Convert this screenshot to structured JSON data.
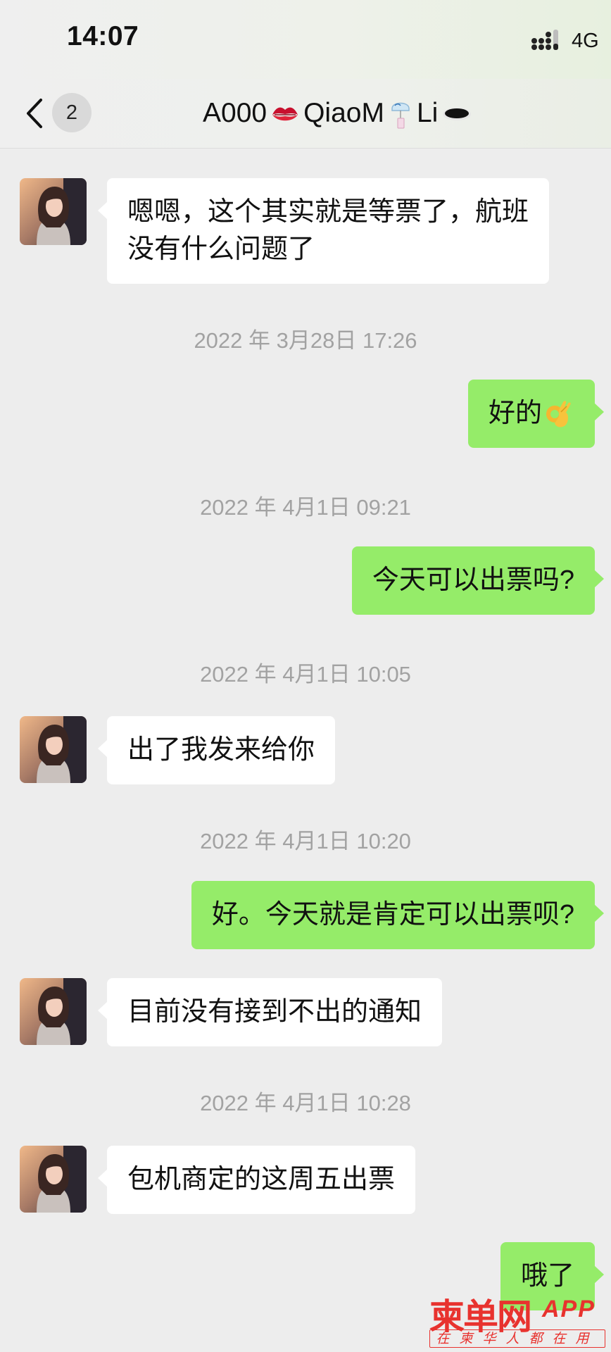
{
  "status_bar": {
    "time": "14:07",
    "network": "4G",
    "signal_icon": "signal-bars-icon"
  },
  "nav": {
    "back_icon": "chevron-left-icon",
    "unread_count": "2",
    "title": {
      "part1": "A000",
      "emoji1": "kiss-mark-icon",
      "part2": "QiaoM",
      "emoji2": "wind-chime-icon",
      "part3": "Li",
      "emoji3": "hole-icon"
    }
  },
  "messages": [
    {
      "type": "in",
      "text": "嗯嗯，这个其实就是等票了，航班\n没有什么问题了"
    },
    {
      "type": "time",
      "text": "2022 年 3月28日 17:26"
    },
    {
      "type": "out",
      "text": "好的",
      "emoji": "ok-hand-icon"
    },
    {
      "type": "time",
      "text": "2022 年 4月1日 09:21"
    },
    {
      "type": "out",
      "text": "今天可以出票吗?"
    },
    {
      "type": "time",
      "text": "2022 年 4月1日 10:05"
    },
    {
      "type": "in",
      "text": "出了我发来给你"
    },
    {
      "type": "time",
      "text": "2022 年 4月1日 10:20"
    },
    {
      "type": "out",
      "text": "好。今天就是肯定可以出票呗?"
    },
    {
      "type": "in",
      "text": "目前没有接到不出的通知"
    },
    {
      "type": "time",
      "text": "2022 年 4月1日 10:28"
    },
    {
      "type": "in",
      "text": "包机商定的这周五出票"
    },
    {
      "type": "out",
      "text": "哦了"
    }
  ],
  "watermark": {
    "brand": "柬单网",
    "app": "APP",
    "slogan": "在柬华人都在用"
  },
  "colors": {
    "background": "#ededed",
    "outgoing_bubble": "#95ec69",
    "incoming_bubble": "#ffffff",
    "timestamp": "#a2a2a2",
    "watermark": "#e8322e"
  }
}
